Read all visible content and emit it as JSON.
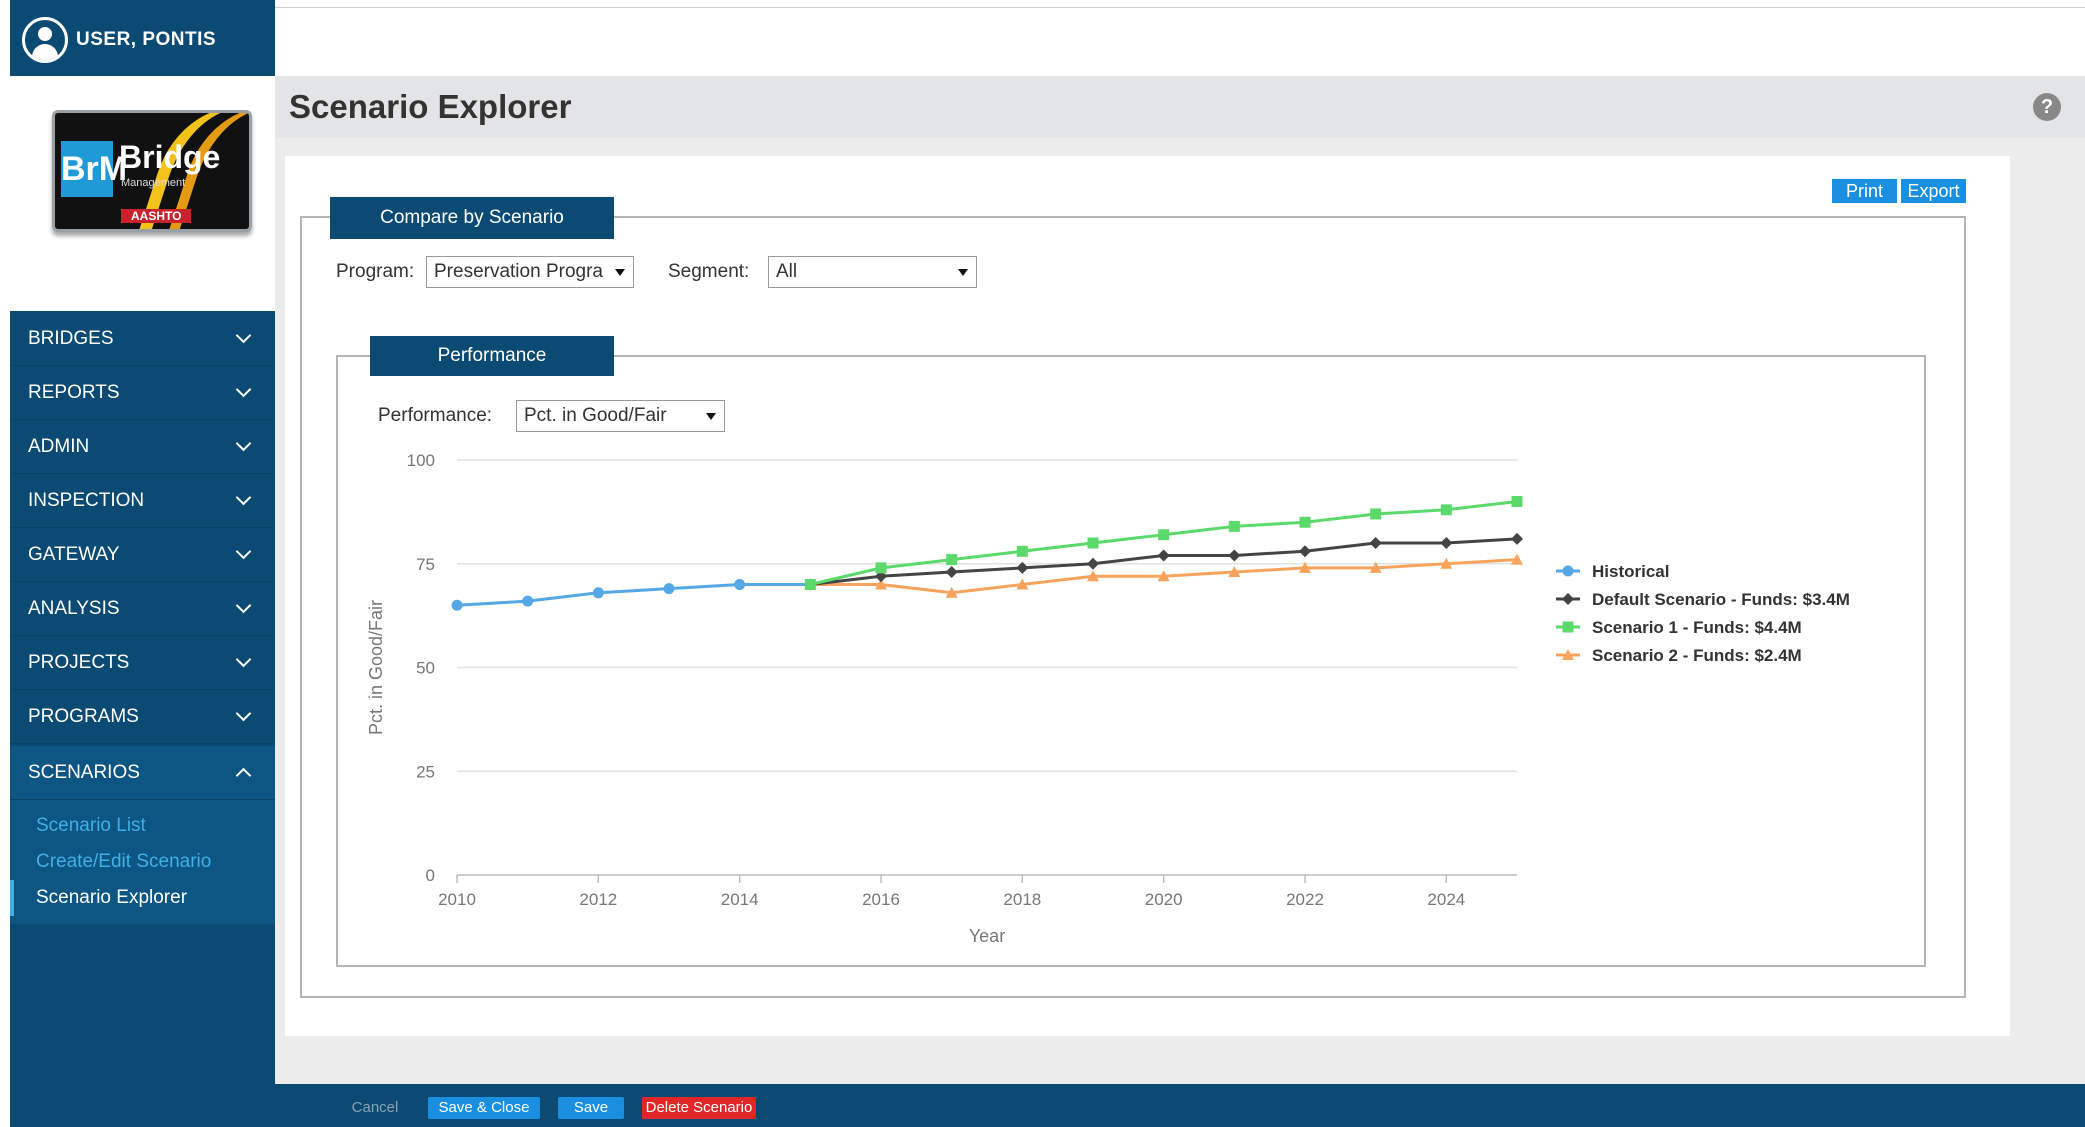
{
  "user": {
    "name": "USER, PONTIS"
  },
  "logo": {
    "br": "BrM",
    "brand": "Bridge",
    "sub": "Management",
    "foot": "AASHTO"
  },
  "nav": {
    "items": [
      {
        "label": "BRIDGES"
      },
      {
        "label": "REPORTS"
      },
      {
        "label": "ADMIN"
      },
      {
        "label": "INSPECTION"
      },
      {
        "label": "GATEWAY"
      },
      {
        "label": "ANALYSIS"
      },
      {
        "label": "PROJECTS"
      },
      {
        "label": "PROGRAMS"
      },
      {
        "label": "SCENARIOS"
      }
    ],
    "sub_items": [
      {
        "label": "Scenario List"
      },
      {
        "label": "Create/Edit Scenario"
      },
      {
        "label": "Scenario Explorer",
        "active": true
      }
    ]
  },
  "header": {
    "title": "Scenario Explorer",
    "help": "?"
  },
  "toolbar": {
    "print": "Print",
    "export": "Export"
  },
  "compare": {
    "tab": "Compare by Scenario",
    "program_label": "Program:",
    "program_value": "Preservation Progra",
    "segment_label": "Segment:",
    "segment_value": "All"
  },
  "performance": {
    "tab": "Performance",
    "label": "Performance:",
    "value": "Pct. in Good/Fair"
  },
  "chart_data": {
    "type": "line",
    "xlabel": "Year",
    "ylabel": "Pct. in Good/Fair",
    "xlim": [
      2010,
      2025
    ],
    "ylim": [
      0,
      100
    ],
    "xticks": [
      2010,
      2012,
      2014,
      2016,
      2018,
      2020,
      2022,
      2024
    ],
    "yticks": [
      0,
      25,
      50,
      75,
      100
    ],
    "grid": true,
    "legend_position": "right",
    "series": [
      {
        "name": "Historical",
        "color": "#55a8e3",
        "marker": "circle",
        "x": [
          2010,
          2011,
          2012,
          2013,
          2014,
          2015
        ],
        "y": [
          65,
          66,
          68,
          69,
          70,
          70
        ]
      },
      {
        "name": "Default Scenario - Funds: $3.4M",
        "color": "#444444",
        "marker": "diamond",
        "x": [
          2015,
          2016,
          2017,
          2018,
          2019,
          2020,
          2021,
          2022,
          2023,
          2024,
          2025
        ],
        "y": [
          70,
          72,
          73,
          74,
          75,
          77,
          77,
          78,
          80,
          80,
          81
        ]
      },
      {
        "name": "Scenario 1 - Funds: $4.4M",
        "color": "#5bd96b",
        "marker": "square",
        "x": [
          2015,
          2016,
          2017,
          2018,
          2019,
          2020,
          2021,
          2022,
          2023,
          2024,
          2025
        ],
        "y": [
          70,
          74,
          76,
          78,
          80,
          82,
          84,
          85,
          87,
          88,
          90
        ]
      },
      {
        "name": "Scenario 2 - Funds: $2.4M",
        "color": "#f7a35c",
        "marker": "triangle",
        "x": [
          2015,
          2016,
          2017,
          2018,
          2019,
          2020,
          2021,
          2022,
          2023,
          2024,
          2025
        ],
        "y": [
          70,
          70,
          68,
          70,
          72,
          72,
          73,
          74,
          74,
          75,
          76
        ]
      }
    ]
  },
  "footer": {
    "cancel": "Cancel",
    "save_close": "Save & Close",
    "save": "Save",
    "delete": "Delete Scenario"
  }
}
